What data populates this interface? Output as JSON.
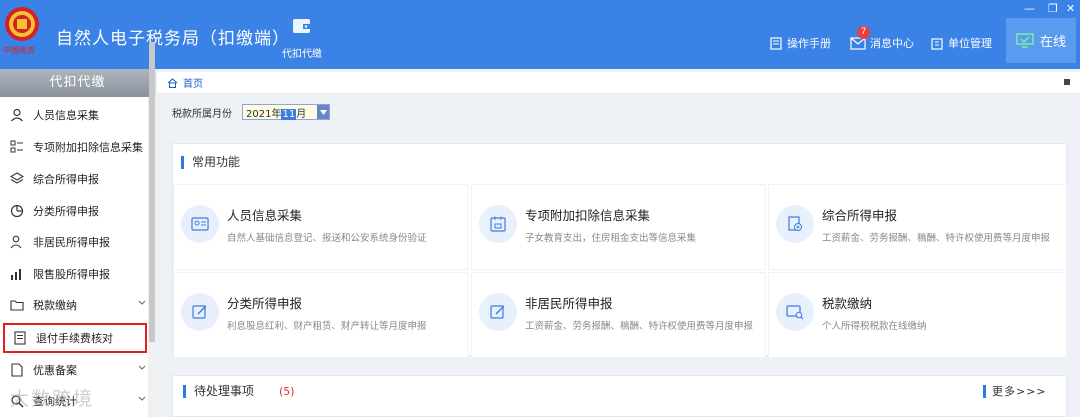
{
  "header": {
    "title": "自然人电子税务局（扣缴端）",
    "logo_text": "中国税务",
    "nav_label": "代扣代缴",
    "manual_label": "操作手册",
    "messages_label": "消息中心",
    "messages_badge": "7",
    "unit_label": "单位管理",
    "status_label": "在线",
    "colors": {
      "bar": "#3b82e6",
      "online": "#5b9bef",
      "badge": "#e8403a"
    }
  },
  "sidebar": {
    "title": "代扣代缴",
    "items": [
      {
        "label": "人员信息采集",
        "icon": "person-icon"
      },
      {
        "label": "专项附加扣除信息采集",
        "icon": "list-icon"
      },
      {
        "label": "综合所得申报",
        "icon": "layers-icon"
      },
      {
        "label": "分类所得申报",
        "icon": "pie-icon"
      },
      {
        "label": "非居民所得申报",
        "icon": "person-outline-icon"
      },
      {
        "label": "限售股所得申报",
        "icon": "bar-chart-icon"
      },
      {
        "label": "税款缴纳",
        "icon": "folder-icon"
      },
      {
        "label": "退付手续费核对",
        "icon": "receipt-icon"
      },
      {
        "label": "优惠备案",
        "icon": "document-icon"
      },
      {
        "label": "查询统计",
        "icon": "search-icon"
      }
    ]
  },
  "breadcrumb": {
    "home": "首页"
  },
  "filter": {
    "label": "税款所属月份",
    "year_part": "2021年",
    "month_part": "11",
    "suffix": "月"
  },
  "common": {
    "title": "常用功能",
    "functions": [
      {
        "name": "人员信息采集",
        "desc": "自然人基础信息登记、报送和公安系统身份验证",
        "icon": "id-card-icon"
      },
      {
        "name": "专项附加扣除信息采集",
        "desc": "子女教育支出，住房租金支出等信息采集",
        "icon": "calendar-icon"
      },
      {
        "name": "综合所得申报",
        "desc": "工资薪金、劳务报酬、稿酬、特许权使用费等月度申报",
        "icon": "doc-add-icon"
      },
      {
        "name": "分类所得申报",
        "desc": "利息股息红利、财产租赁、财产转让等月度申报",
        "icon": "edit-icon"
      },
      {
        "name": "非居民所得申报",
        "desc": "工资薪金、劳务报酬、稿酬、特许权使用费等月度申报",
        "icon": "edit-icon"
      },
      {
        "name": "税款缴纳",
        "desc": "个人所得税税款在线缴纳",
        "icon": "card-search-icon"
      }
    ]
  },
  "pending": {
    "title": "待处理事项",
    "count": "(5)",
    "more": "更多>>>"
  },
  "watermark": "大数跨境"
}
